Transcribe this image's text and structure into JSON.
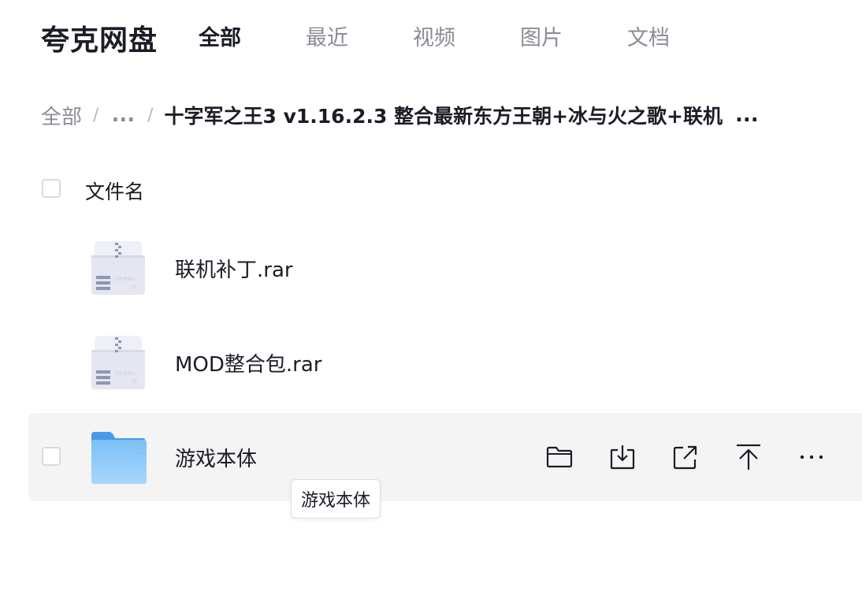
{
  "app": {
    "title": "夸克网盘"
  },
  "tabs": [
    {
      "label": "全部",
      "active": true
    },
    {
      "label": "最近"
    },
    {
      "label": "视频"
    },
    {
      "label": "图片"
    },
    {
      "label": "文档"
    }
  ],
  "breadcrumb": {
    "root": "全部",
    "separator": "/",
    "collapsed": "...",
    "current": "十字军之王3  v1.16.2.3 整合最新东方王朝+冰与火之歌+联机",
    "overflow": "..."
  },
  "list": {
    "header": {
      "name_label": "文件名"
    },
    "rows": [
      {
        "name": "联机补丁.rar",
        "type": "archive",
        "icon": "zip-archive-icon",
        "icon_text": "ZIP/RAR/7Z"
      },
      {
        "name": "MOD整合包.rar",
        "type": "archive",
        "icon": "zip-archive-icon",
        "icon_text": "ZIP/RAR/7Z"
      },
      {
        "name": "游戏本体",
        "type": "folder",
        "icon": "folder-icon",
        "hovered": true
      }
    ],
    "row_actions": [
      {
        "name": "move-to-folder",
        "icon": "folder-outline-icon"
      },
      {
        "name": "download",
        "icon": "download-icon"
      },
      {
        "name": "share",
        "icon": "share-icon"
      },
      {
        "name": "move-to-top",
        "icon": "pin-top-icon"
      },
      {
        "name": "more",
        "icon": "more-dots-icon"
      }
    ]
  },
  "tooltip": {
    "text": "游戏本体"
  },
  "colors": {
    "text_primary": "#1b1d26",
    "text_secondary": "#8a8d96",
    "row_hover_bg": "#f4f4f5",
    "folder_blue": "#6cb4f2",
    "archive_gray": "#e4e7f2"
  }
}
